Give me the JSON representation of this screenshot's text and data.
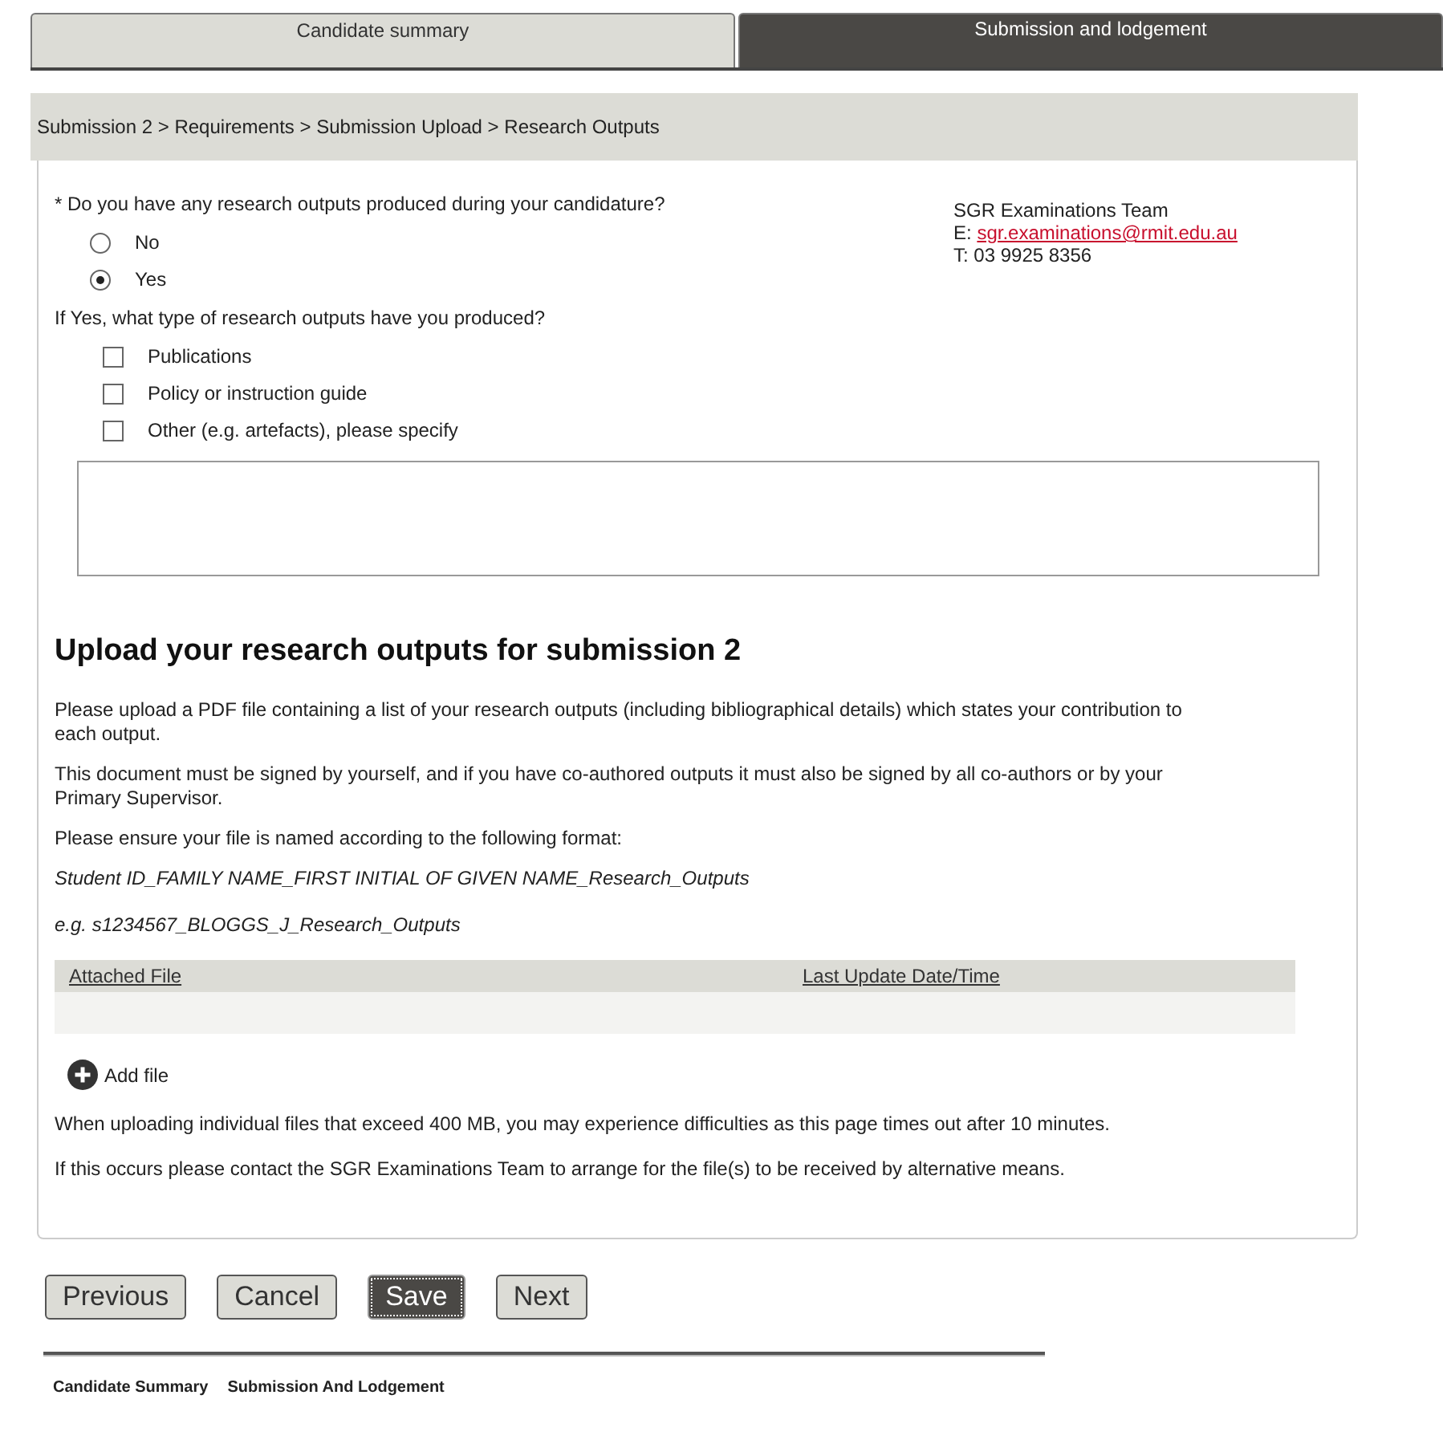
{
  "tabs": [
    {
      "label": "Candidate summary",
      "selected": false
    },
    {
      "label": "Submission and lodgement",
      "selected": true
    }
  ],
  "breadcrumb": "Submission 2 > Requirements > Submission Upload > Research Outputs",
  "question": "* Do you have any research outputs produced during your candidature?",
  "radios": [
    {
      "label": "No",
      "selected": false
    },
    {
      "label": "Yes",
      "selected": true
    }
  ],
  "contact": {
    "team": "SGR Examinations Team",
    "email_prefix": "E:",
    "email": "sgr.examinations@rmit.edu.au",
    "phone": "T: 03 9925 8356"
  },
  "type_question": "If Yes, what type of research outputs have you produced?",
  "checkboxes": [
    {
      "label": "Publications",
      "checked": false
    },
    {
      "label": "Policy or instruction guide",
      "checked": false
    },
    {
      "label": "Other (e.g. artefacts), please specify",
      "checked": false
    }
  ],
  "upload": {
    "heading": "Upload your research outputs for submission 2",
    "paragraphs": [
      "Please upload a PDF file containing a list of your research outputs (including bibliographical details) which states your contribution to each output.",
      "This document must be signed by yourself, and if you have co-authored outputs it must also be signed by all co-authors or by your Primary Supervisor.",
      "Please ensure your file is named according to the following format:"
    ],
    "format": "Student ID_FAMILY NAME_FIRST INITIAL OF GIVEN NAME_Research_Outputs",
    "example": "e.g. s1234567_BLOGGS_J_Research_Outputs",
    "columns": [
      "Attached File",
      "Last Update Date/Time"
    ],
    "add_file": "Add file",
    "notes": [
      "When uploading individual files that exceed 400 MB, you may experience difficulties as this page times out after 10 minutes.",
      "If this occurs please contact the SGR Examinations Team to arrange for the file(s) to be received by alternative means."
    ]
  },
  "buttons": [
    {
      "label": "Previous",
      "focused": false
    },
    {
      "label": "Cancel",
      "focused": false
    },
    {
      "label": "Save",
      "focused": true
    },
    {
      "label": "Next",
      "focused": false
    }
  ],
  "footer_links": [
    "Candidate Summary",
    "Submission And Lodgement"
  ]
}
